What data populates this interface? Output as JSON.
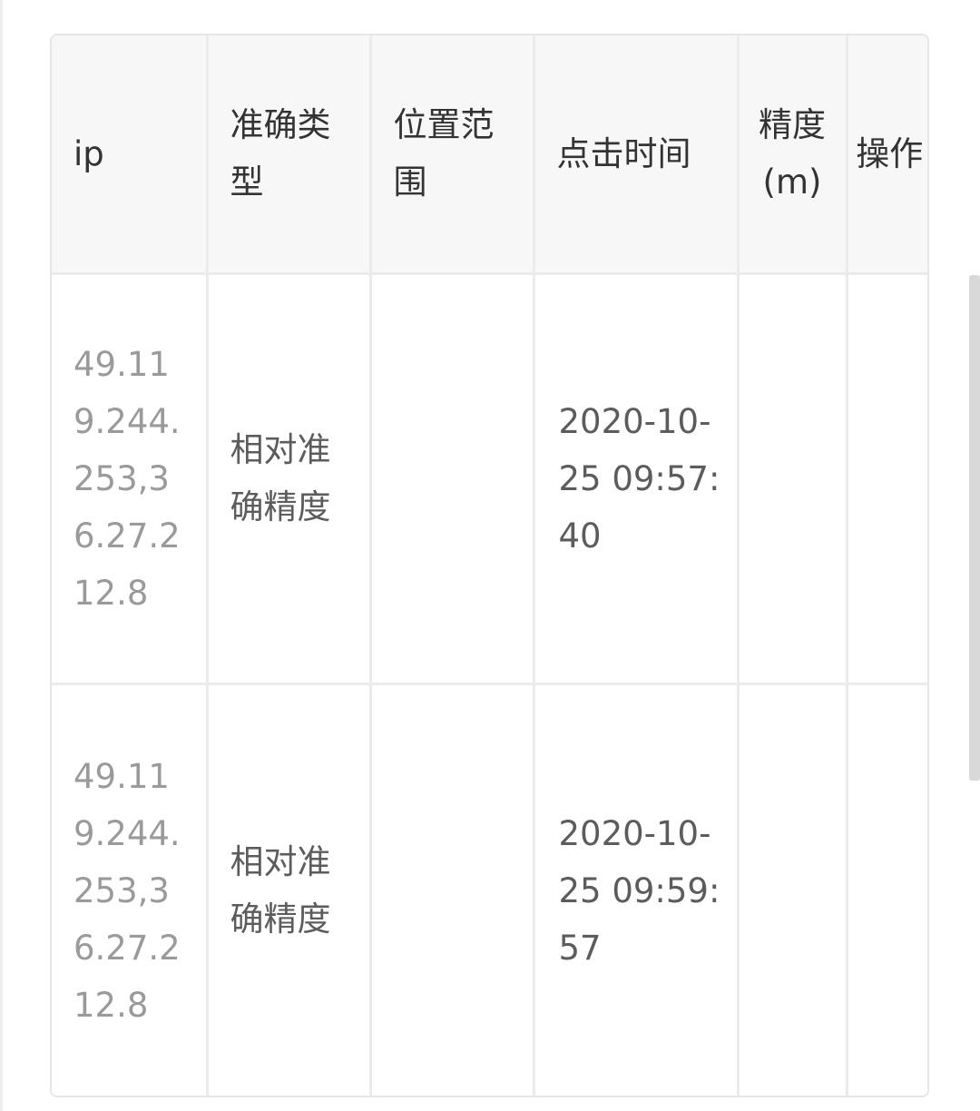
{
  "table": {
    "headers": {
      "ip": "ip",
      "accuracy_type": "准确类型",
      "position_range": "位置范围",
      "click_time": "点击时间",
      "precision": "精度(m)",
      "action": "操作"
    },
    "rows": [
      {
        "ip": "49.119.244.253,36.27.212.8",
        "accuracy_type": "相对准确精度",
        "position_range": "",
        "click_time": "2020-10-25 09:57:40",
        "precision": "",
        "action": ""
      },
      {
        "ip": "49.119.244.253,36.27.212.8",
        "accuracy_type": "相对准确精度",
        "position_range": "",
        "click_time": "2020-10-25 09:59:57",
        "precision": "",
        "action": ""
      }
    ]
  }
}
